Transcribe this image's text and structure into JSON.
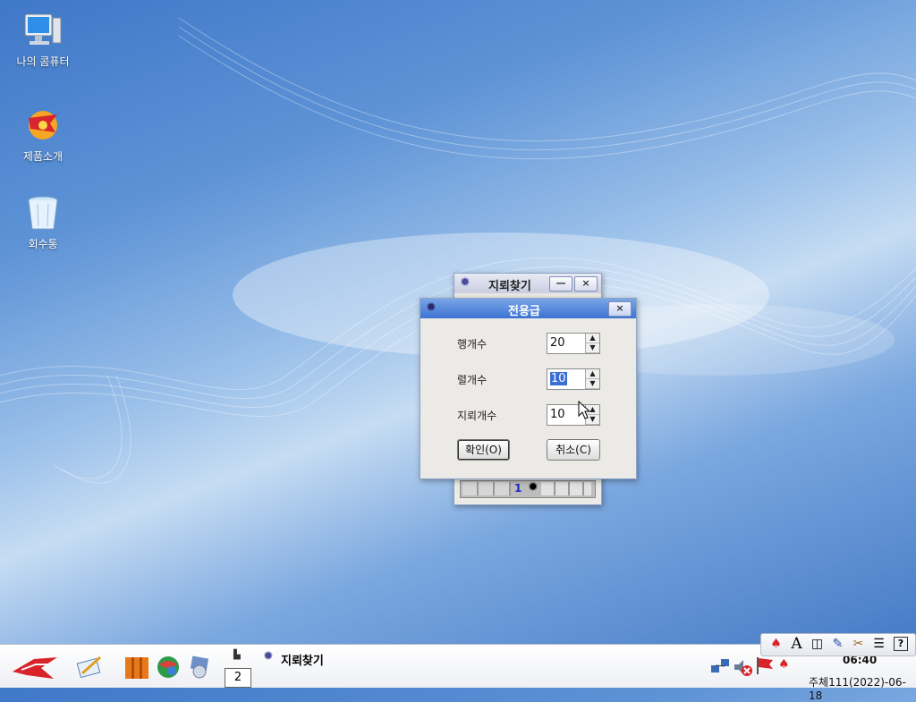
{
  "desktop": {
    "icons": [
      {
        "label": "나의 콤퓨터",
        "icon": "computer-icon"
      },
      {
        "label": "제품소개",
        "icon": "product-intro-icon"
      },
      {
        "label": "회수통",
        "icon": "recycle-bin-icon"
      }
    ]
  },
  "minesweeper_window": {
    "title": "지뢰찾기",
    "minimize": "—",
    "close": "×",
    "status_cell_number": "1"
  },
  "custom_dialog": {
    "title": "전용급",
    "close": "×",
    "rows_label": "행개수",
    "rows_value": "20",
    "cols_label": "렬개수",
    "cols_value": "10",
    "mines_label": "지뢰개수",
    "mines_value": "10",
    "ok_button": "확인(O)",
    "cancel_button": "취소(C)",
    "spin_up": "▲",
    "spin_down": "▼"
  },
  "taskbar": {
    "workspace_number": "2",
    "task_title": "지뢰찾기",
    "clock_time": "06:40",
    "clock_date": "주체111(2022)-06-18",
    "tray_glyphs": {
      "font": "A",
      "help": "?"
    }
  },
  "colors": {
    "title_active": "#3c74d4",
    "selection": "#3b6fd1",
    "desktop_blue": "#4f86cf"
  }
}
